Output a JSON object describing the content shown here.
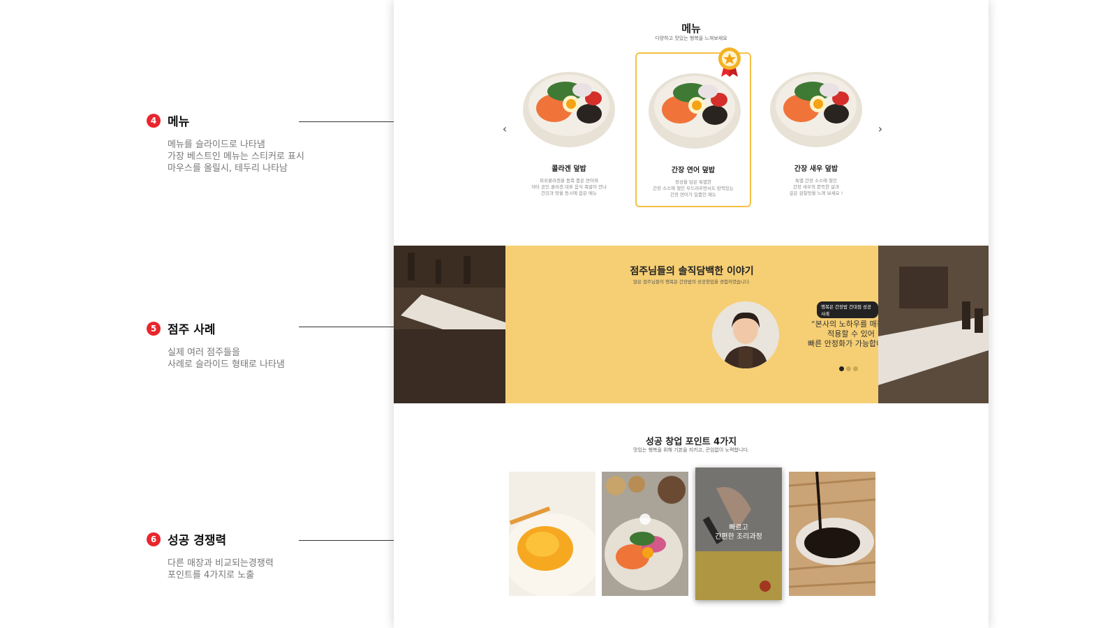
{
  "annotations": [
    {
      "number": "4",
      "title": "메뉴",
      "desc": "메뉴를 슬라이드로 나타냄\n가장 베스트인 메뉴는 스티커로 표시\n마우스를 올릴시, 테두리 나타남"
    },
    {
      "number": "5",
      "title": "점주 사례",
      "desc": "실제 여러 점주들을\n사례로 슬라이드 형태로 나타냄"
    },
    {
      "number": "6",
      "title": "성공 경쟁력",
      "desc": "다른 매장과 비교되는경쟁력\n포인트를 4가지로 노출"
    }
  ],
  "menu": {
    "title": "메뉴",
    "subtitle": "다양하고 맛있는 행복을 느껴보세요",
    "prev_icon": "chevron-left-icon",
    "next_icon": "chevron-right-icon",
    "items": [
      {
        "name": "콜라겐 덮밥",
        "desc": "피쉬콜라겐을 듬뿍 품은 연어와\n자타 공인 콜라겐 대표 음식 족발이 만나\n건강과 맛을 동시에 잡은 메뉴"
      },
      {
        "name": "간장 연어 덮밥",
        "desc": "정성을 담은 특별한\n간장 소스에 절인 부드러우면서도 탄력있는\n간장 연어가 일품인 메뉴",
        "best": true
      },
      {
        "name": "간장 새우 덮밥",
        "desc": "특별 간장 소스에 절인\n간장 새우의 쫀득한 살과\n깊은 감칠맛을 느껴 보세요 !"
      }
    ]
  },
  "stories": {
    "title": "점주님들의 솔직담백한 이야기",
    "subtitle": "많은 점주님들이 행복은 간장밥의 성공창업을 경험하였습니다.",
    "badge": "행복은 간장밥 건대점 성공사례",
    "quote": "“본사의 노하우를 매장에\n적용할 수 있어\n빠른 안정화가 가능합니다”",
    "active_dot": 0,
    "dot_count": 3
  },
  "points": {
    "title": "성공 창업 포인트 4가지",
    "subtitle": "맛있는 행복을 위해 기본을 지키고, 끈임없이 노력합니다.",
    "active_label": "빠르고\n간편한 조리과정"
  },
  "colors": {
    "accent": "#f4c145",
    "banner": "#f6cf74",
    "number_badge": "#e8262c"
  }
}
